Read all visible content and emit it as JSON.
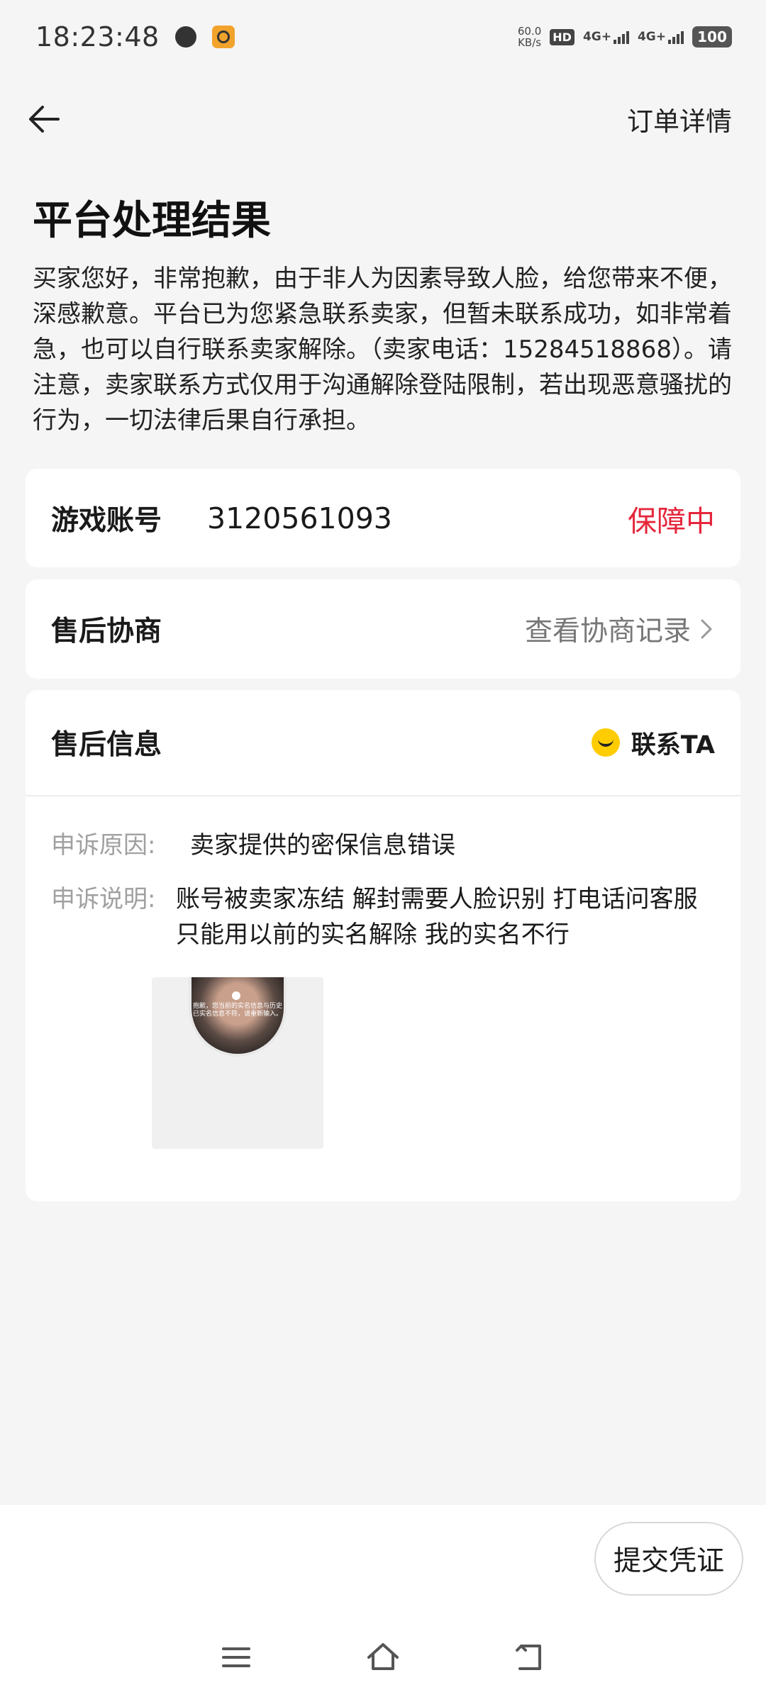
{
  "status_bar": {
    "time": "18:23:48",
    "speed_top": "60.0",
    "speed_unit": "KB/s",
    "hd": "HD",
    "sim1": "4G+",
    "sim2": "4G+",
    "battery": "100"
  },
  "header": {
    "order_details": "订单详情"
  },
  "result": {
    "title": "平台处理结果",
    "body": "买家您好，非常抱歉，由于非人为因素导致人脸，给您带来不便，深感歉意。平台已为您紧急联系卖家，但暂未联系成功，如非常着急，也可以自行联系卖家解除。（卖家电话：15284518868）。请注意，卖家联系方式仅用于沟通解除登陆限制，若出现恶意骚扰的行为，一切法律后果自行承担。"
  },
  "account_card": {
    "label": "游戏账号",
    "number": "3120561093",
    "status": "保障中",
    "status_color": "#e5263b"
  },
  "negotiation_card": {
    "label": "售后协商",
    "link": "查看协商记录"
  },
  "info_card": {
    "label": "售后信息",
    "contact": "联系TA",
    "reason_key": "申诉原因:",
    "reason_val": "卖家提供的密保信息错误",
    "desc_key": "申诉说明:",
    "desc_val": "账号被卖家冻结 解封需要人脸识别  打电话问客服 只能用以前的实名解除  我的实名不行",
    "thumb_text": "抱歉，您当前的实名信息与历史已实名信息不符，请重新输入。"
  },
  "footer": {
    "submit": "提交凭证"
  }
}
